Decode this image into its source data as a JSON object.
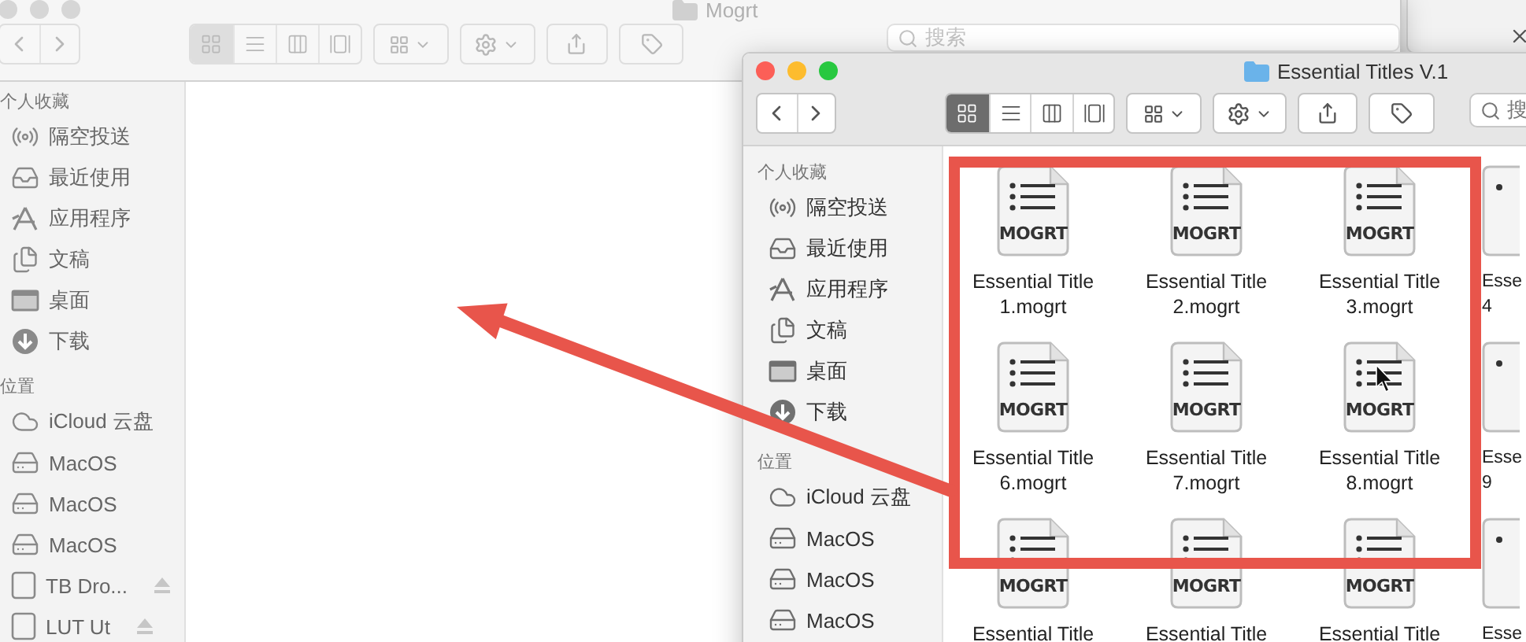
{
  "back_window": {
    "title": "Mogrt",
    "active": false,
    "search": {
      "placeholder": "搜索"
    },
    "view_modes": [
      {
        "kind": "icons",
        "selected": true
      },
      {
        "kind": "list",
        "selected": false
      },
      {
        "kind": "columns",
        "selected": false
      },
      {
        "kind": "gallery",
        "selected": false
      }
    ],
    "sidebar": [
      {
        "heading": "个人收藏",
        "items": [
          {
            "kind": "airdrop",
            "label": "隔空投送",
            "eject": false
          },
          {
            "kind": "recents",
            "label": "最近使用",
            "eject": false
          },
          {
            "kind": "applications",
            "label": "应用程序",
            "eject": false
          },
          {
            "kind": "documents",
            "label": "文稿",
            "eject": false
          },
          {
            "kind": "desktop",
            "label": "桌面",
            "eject": false
          },
          {
            "kind": "downloads",
            "label": "下载",
            "eject": false
          }
        ]
      },
      {
        "heading": "位置",
        "items": [
          {
            "kind": "icloud",
            "label": "iCloud 云盘",
            "eject": false
          },
          {
            "kind": "disk",
            "label": "MacOS",
            "eject": false
          },
          {
            "kind": "disk",
            "label": "MacOS",
            "eject": false
          },
          {
            "kind": "disk",
            "label": "MacOS",
            "eject": false
          },
          {
            "kind": "drive",
            "label": "TB Dro...",
            "eject": true
          },
          {
            "kind": "drive",
            "label": "LUT Ut",
            "eject": true
          }
        ]
      }
    ]
  },
  "front_window": {
    "title": "Essential Titles V.1",
    "active": true,
    "search": {
      "placeholder": "搜"
    },
    "view_modes": [
      {
        "kind": "icons",
        "selected": true
      },
      {
        "kind": "list",
        "selected": false
      },
      {
        "kind": "columns",
        "selected": false
      },
      {
        "kind": "gallery",
        "selected": false
      }
    ],
    "sidebar": [
      {
        "heading": "个人收藏",
        "items": [
          {
            "kind": "airdrop",
            "label": "隔空投送",
            "eject": false
          },
          {
            "kind": "recents",
            "label": "最近使用",
            "eject": false
          },
          {
            "kind": "applications",
            "label": "应用程序",
            "eject": false
          },
          {
            "kind": "documents",
            "label": "文稿",
            "eject": false
          },
          {
            "kind": "desktop",
            "label": "桌面",
            "eject": false
          },
          {
            "kind": "downloads",
            "label": "下载",
            "eject": false
          }
        ]
      },
      {
        "heading": "位置",
        "items": [
          {
            "kind": "icloud",
            "label": "iCloud 云盘",
            "eject": false
          },
          {
            "kind": "disk",
            "label": "MacOS",
            "eject": false
          },
          {
            "kind": "disk",
            "label": "MacOS",
            "eject": false
          },
          {
            "kind": "disk",
            "label": "MacOS",
            "eject": false
          }
        ]
      }
    ]
  },
  "files": [
    {
      "kind": "full",
      "label": "Essential Title 1.mogrt",
      "type": "MOGRT"
    },
    {
      "kind": "full",
      "label": "Essential Title 2.mogrt",
      "type": "MOGRT"
    },
    {
      "kind": "full",
      "label": "Essential Title 3.mogrt",
      "type": "MOGRT"
    },
    {
      "kind": "cut",
      "label": "Esse 4"
    },
    {
      "kind": "full",
      "label": "Essential Title 6.mogrt",
      "type": "MOGRT"
    },
    {
      "kind": "full",
      "label": "Essential Title 7.mogrt",
      "type": "MOGRT"
    },
    {
      "kind": "full",
      "label": "Essential Title 8.mogrt",
      "type": "MOGRT"
    },
    {
      "kind": "cut",
      "label": "Esse 9"
    },
    {
      "kind": "full",
      "label": "Essential Title",
      "type": "MOGRT"
    },
    {
      "kind": "full",
      "label": "Essential Title",
      "type": "MOGRT"
    },
    {
      "kind": "full",
      "label": "Essential Title",
      "type": "MOGRT"
    },
    {
      "kind": "cut",
      "label": "Esse"
    }
  ]
}
